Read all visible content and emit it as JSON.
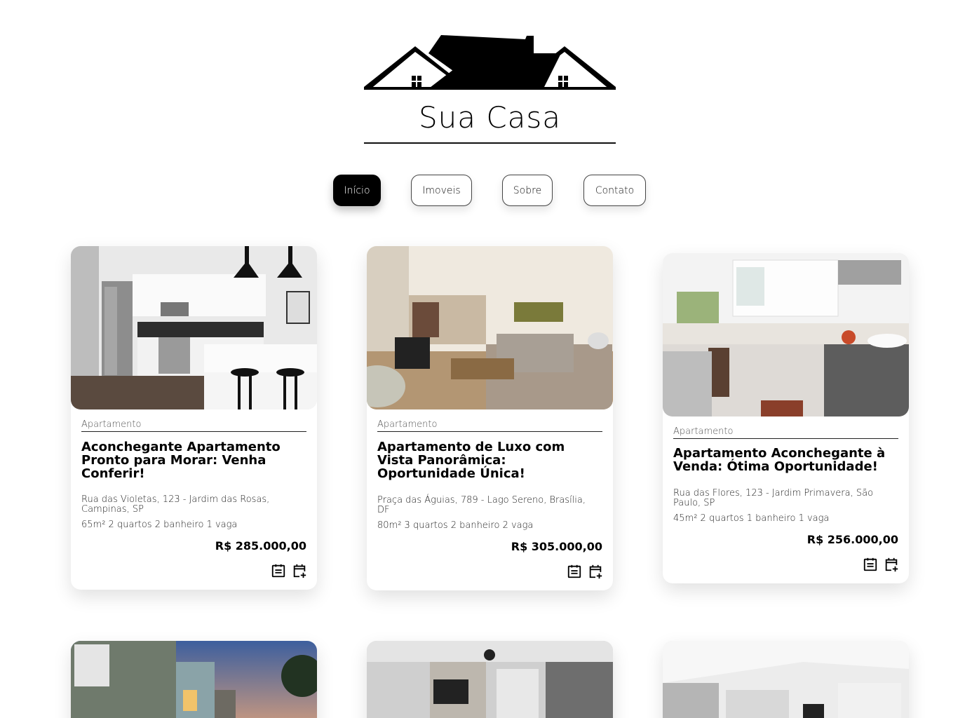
{
  "brand": {
    "name": "Sua Casa"
  },
  "nav": {
    "items": [
      {
        "label": "Início",
        "active": true
      },
      {
        "label": "Imoveis",
        "active": false
      },
      {
        "label": "Sobre",
        "active": false
      },
      {
        "label": "Contato",
        "active": false
      }
    ]
  },
  "listings": [
    {
      "type": "Apartamento",
      "title": "Aconchegante Apartamento Pronto para Morar: Venha Conferir!",
      "address": "Rua das Violetas, 123 - Jardim das Rosas, Campinas, SP",
      "specs": "65m² 2 quartos 2 banheiro 1 vaga",
      "price": "R$ 285.000,00",
      "icons": [
        "calendar-details-icon",
        "calendar-add-icon"
      ]
    },
    {
      "type": "Apartamento",
      "title": "Apartamento de Luxo com Vista Panorâmica: Oportunidade Única!",
      "address": "Praça das Águias, 789 - Lago Sereno, Brasília, DF",
      "specs": "80m² 3 quartos 2 banheiro 2 vaga",
      "price": "R$ 305.000,00",
      "icons": [
        "calendar-details-icon",
        "calendar-add-icon"
      ]
    },
    {
      "type": "Apartamento",
      "title": "Apartamento Aconchegante à Venda: Ótima Oportunidade!",
      "address": "Rua das Flores, 123 - Jardim Primavera, São Paulo, SP",
      "specs": "45m² 2 quartos 1 banheiro 1 vaga",
      "price": "R$ 256.000,00",
      "icons": [
        "calendar-details-icon",
        "calendar-add-icon"
      ]
    }
  ]
}
